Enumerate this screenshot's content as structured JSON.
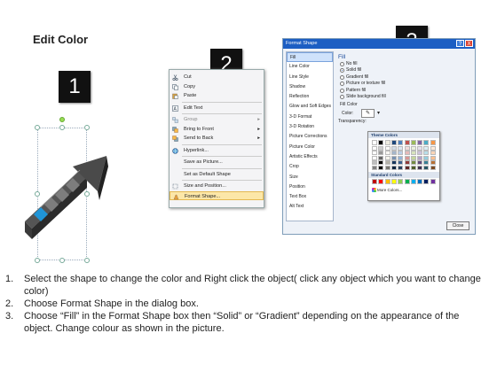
{
  "title": "Edit Color",
  "steps": [
    "1",
    "2",
    "3"
  ],
  "context_menu": {
    "items": [
      {
        "label": "Cut",
        "icon": "scissors-icon",
        "submenu": false
      },
      {
        "label": "Copy",
        "icon": "copy-icon",
        "submenu": false
      },
      {
        "label": "Paste",
        "icon": "paste-icon",
        "submenu": false
      },
      {
        "label": "Edit Text",
        "icon": "edit-text-icon",
        "submenu": false
      },
      {
        "label": "Group",
        "icon": "group-icon",
        "submenu": true
      },
      {
        "label": "Bring to Front",
        "icon": "bring-front-icon",
        "submenu": true
      },
      {
        "label": "Send to Back",
        "icon": "send-back-icon",
        "submenu": true
      },
      {
        "label": "Hyperlink...",
        "icon": "hyperlink-icon",
        "submenu": false
      },
      {
        "label": "Save as Picture...",
        "icon": "",
        "submenu": false
      },
      {
        "label": "Set as Default Shape",
        "icon": "",
        "submenu": false
      },
      {
        "label": "Size and Position...",
        "icon": "size-position-icon",
        "submenu": false
      },
      {
        "label": "Format Shape...",
        "icon": "format-shape-icon",
        "submenu": false
      }
    ],
    "highlighted_index": 11
  },
  "dialog": {
    "title": "Format Shape",
    "help_label": "?",
    "close_label": "X",
    "categories": [
      "Fill",
      "Line Color",
      "Line Style",
      "Shadow",
      "Reflection",
      "Glow and Soft Edges",
      "3-D Format",
      "3-D Rotation",
      "Picture Corrections",
      "Picture Color",
      "Artistic Effects",
      "Crop",
      "Size",
      "Position",
      "Text Box",
      "Alt Text"
    ],
    "selected_category": 0,
    "fill_heading": "Fill",
    "fill_options": [
      "No fill",
      "Solid fill",
      "Gradient fill",
      "Picture or texture fill",
      "Pattern fill",
      "Slide background fill"
    ],
    "selected_fill": 1,
    "fill_color_label": "Fill Color",
    "color_label": "Color:",
    "transparency_label": "Transparency:",
    "close_button": "Close",
    "popup": {
      "theme_heading": "Theme Colors",
      "standard_heading": "Standard Colors",
      "more_colors": "More Colors...",
      "theme_top": [
        "#ffffff",
        "#000000",
        "#eeece1",
        "#1f497d",
        "#4f81bd",
        "#c0504d",
        "#9bbb59",
        "#8064a2",
        "#4bacc6",
        "#f79646"
      ],
      "standard": [
        "#c00000",
        "#ff0000",
        "#ffc000",
        "#ffff00",
        "#92d050",
        "#00b050",
        "#00b0f0",
        "#0070c0",
        "#002060",
        "#7030a0"
      ]
    }
  },
  "instructions": [
    {
      "num": "1.",
      "text": "Select the shape to change the color and Right click the object( click any object which you want to change color)"
    },
    {
      "num": "2.",
      "text": "Choose Format Shape in the dialog box."
    },
    {
      "num": "3.",
      "text": "Choose “Fill” in the Format Shape box then “Solid” or “Gradient” depending on the appearance of the object. Change colour as shown in the picture."
    }
  ]
}
